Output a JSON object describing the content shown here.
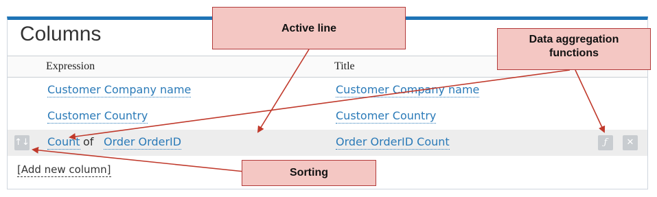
{
  "panel": {
    "title": "Columns",
    "headers": {
      "expression": "Expression",
      "title": "Title"
    },
    "rows": [
      {
        "expression": "Customer Company name",
        "title": "Customer Company name"
      },
      {
        "expression": "Customer Country",
        "title": "Customer Country"
      },
      {
        "aggregate": "Count",
        "of": "of",
        "expression": "Order OrderID",
        "title": "Order OrderID Count",
        "active": true
      }
    ],
    "add_column": "[Add new column]"
  },
  "icons": {
    "sort": "sort-arrows-icon",
    "function": "function-icon",
    "remove": "close-icon",
    "sort_glyph": "↑↓",
    "function_glyph": "ƒ",
    "remove_glyph": "✕"
  },
  "callouts": {
    "active_line": "Active line",
    "aggregation": "Data aggregation functions",
    "sorting": "Sorting"
  },
  "colors": {
    "accent": "#1f74b6",
    "link": "#2a7ab8",
    "callout_fill": "#f4c7c3",
    "callout_border": "#b23a3a",
    "arrow": "#c0392b"
  }
}
